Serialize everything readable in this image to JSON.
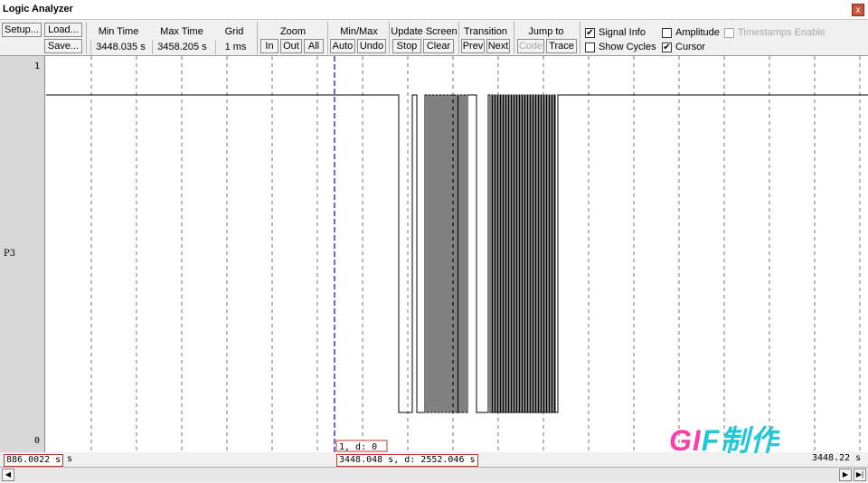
{
  "window": {
    "title": "Logic Analyzer",
    "close_glyph": "x"
  },
  "toolbar": {
    "setup_label": "Setup...",
    "load_label": "Load...",
    "save_label": "Save...",
    "min_time": {
      "header": "Min Time",
      "value": "3448.035 s"
    },
    "max_time": {
      "header": "Max Time",
      "value": "3458.205 s"
    },
    "grid": {
      "header": "Grid",
      "value": "1 ms"
    },
    "zoom": {
      "header": "Zoom",
      "in_label": "In",
      "out_label": "Out",
      "all_label": "All"
    },
    "minmax": {
      "header": "Min/Max",
      "auto_label": "Auto",
      "undo_label": "Undo"
    },
    "update_screen": {
      "header": "Update Screen",
      "stop_label": "Stop",
      "clear_label": "Clear"
    },
    "transition": {
      "header": "Transition",
      "prev_label": "Prev",
      "next_label": "Next"
    },
    "jump_to": {
      "header": "Jump to",
      "code_label": "Code",
      "trace_label": "Trace"
    },
    "options": {
      "signal_info": {
        "label": "Signal Info",
        "checked": true
      },
      "amplitude": {
        "label": "Amplitude",
        "checked": false
      },
      "timestamps": {
        "label": "Timestamps Enable",
        "checked": false,
        "enabled": false
      },
      "show_cycles": {
        "label": "Show Cycles",
        "checked": false
      },
      "cursor": {
        "label": "Cursor",
        "checked": true
      }
    },
    "check_glyph": "✔"
  },
  "signal": {
    "name": "P3",
    "level_high_label": "1",
    "level_low_label": "0"
  },
  "plot": {
    "cursor_label": "1,  d: 0"
  },
  "status": {
    "left_value": "886.0022 s",
    "left_suffix": "s",
    "cursor_readout": "3448.048 s,  d: 2552.046 s",
    "right_value": "3448.22 s"
  },
  "watermark": {
    "text": "GIF制作"
  },
  "colors": {
    "trace": "#000000",
    "grid": "#555555",
    "cursor": "#3a3ab8",
    "highlight_box": "#c0392b",
    "watermark_g": "#ff3da6",
    "watermark_rest": "#20c8d8"
  }
}
